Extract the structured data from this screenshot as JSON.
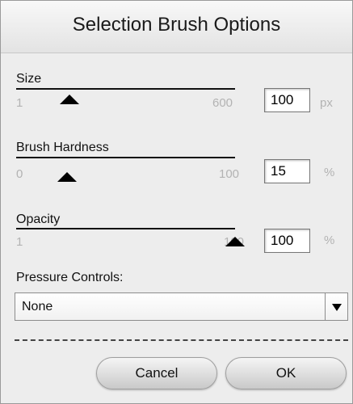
{
  "dialog": {
    "title": "Selection Brush Options"
  },
  "size": {
    "label": "Size",
    "min": "1",
    "max": "600",
    "value": "100",
    "unit": "px",
    "slider_fraction": 0.165
  },
  "hardness": {
    "label": "Brush Hardness",
    "min": "0",
    "max": "100",
    "value": "15",
    "unit": "%",
    "slider_fraction": 0.15
  },
  "opacity": {
    "label": "Opacity",
    "min": "1",
    "max": "100",
    "value": "100",
    "unit": "%",
    "slider_fraction": 1.0
  },
  "pressure": {
    "label": "Pressure Controls:",
    "selected": "None",
    "arrow_icon": "triangle-down-icon"
  },
  "buttons": {
    "cancel": "Cancel",
    "ok": "OK"
  }
}
